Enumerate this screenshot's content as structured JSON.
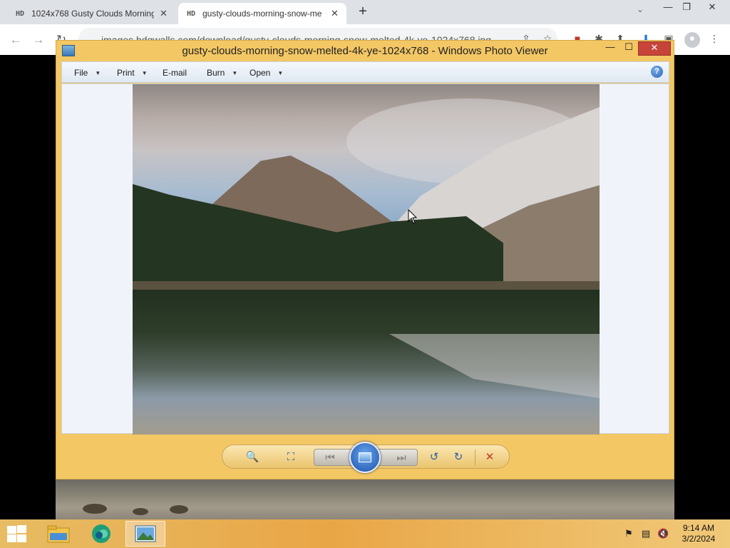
{
  "browser": {
    "tabs": [
      {
        "favicon": "HD",
        "title": "1024x768 Gusty Clouds Morning",
        "active": false
      },
      {
        "favicon": "HD",
        "title": "gusty-clouds-morning-snow-me",
        "active": true
      }
    ],
    "new_tab_glyph": "+",
    "window_controls": {
      "minimize": "—",
      "restore": "❐",
      "close": "✕"
    },
    "tab_search_glyph": "⌄",
    "address": "images.hdqwalls.com/download/gusty-clouds-morning-snow-melted-4k-ye-1024x768.jpg"
  },
  "viewer": {
    "title": "gusty-clouds-morning-snow-melted-4k-ye-1024x768 - Windows Photo Viewer",
    "window_controls": {
      "minimize": "—",
      "maximize": "☐",
      "close": "✕"
    },
    "menu": [
      {
        "label": "File",
        "has_dropdown": true
      },
      {
        "label": "Print",
        "has_dropdown": true
      },
      {
        "label": "E-mail",
        "has_dropdown": false
      },
      {
        "label": "Burn",
        "has_dropdown": true
      },
      {
        "label": "Open",
        "has_dropdown": true
      }
    ],
    "help_glyph": "?",
    "controls": {
      "zoom": "🔍",
      "actual_size": "⛶",
      "previous": "⏮",
      "next": "⏭",
      "rotate_ccw": "↺",
      "rotate_cw": "↻",
      "delete": "✕"
    }
  },
  "taskbar": {
    "clock_time": "9:14 AM",
    "clock_date": "3/2/2024",
    "accent": "#e9a647"
  }
}
